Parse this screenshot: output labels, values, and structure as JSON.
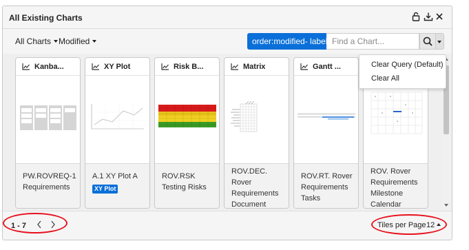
{
  "window": {
    "title": "All Existing Charts"
  },
  "toolbar": {
    "filter_label": "All Charts",
    "sort_label": "Modified",
    "query_badge": "order:modified- label...",
    "search_placeholder": "Find a Chart..."
  },
  "query_menu": {
    "items": [
      "Clear Query (Default)",
      "Clear All"
    ]
  },
  "cards": [
    {
      "title": "Kanba...",
      "description": "PW.ROVREQ-1 Requirements",
      "tag": ""
    },
    {
      "title": "XY Plot",
      "description": "A.1 XY Plot A",
      "tag": "XY Plot"
    },
    {
      "title": "Risk B...",
      "description": "ROV.RSK Testing Risks",
      "tag": ""
    },
    {
      "title": "Matrix",
      "description": "ROV.DEC. Rover Requirements Document",
      "tag": ""
    },
    {
      "title": "Gantt ...",
      "description": "ROV.RT. Rover Requirements Tasks",
      "tag": ""
    },
    {
      "title": "",
      "description": "ROV. Rover Requirements Milestone Calendar",
      "tag": ""
    }
  ],
  "pagination": {
    "range": "1 - 7",
    "tiles_label": "Tiles per Page",
    "tiles_value": "12"
  },
  "colors": {
    "accent": "#0a6fd8",
    "annotation": "#e8101c"
  },
  "icons": [
    "lock-icon",
    "download-icon",
    "close-icon",
    "chart-icon",
    "search-icon",
    "chevron-left-icon",
    "chevron-right-icon"
  ]
}
